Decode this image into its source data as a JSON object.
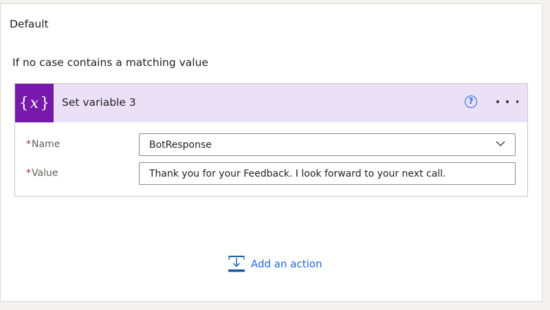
{
  "default_panel": {
    "title": "Default",
    "description": "If no case contains a matching value"
  },
  "action_card": {
    "icon": "variable-icon",
    "title": "Set variable 3",
    "header_color": "#ebe1f7",
    "icon_color": "#7719aa",
    "fields": {
      "name": {
        "required_marker": "*",
        "label": "Name",
        "value": "BotResponse"
      },
      "value": {
        "required_marker": "*",
        "label": "Value",
        "value": "Thank you for your Feedback. I look forward to your next call."
      }
    }
  },
  "add_action": {
    "label": "Add an action",
    "icon": "add-action-icon",
    "color": "#2266e3"
  }
}
